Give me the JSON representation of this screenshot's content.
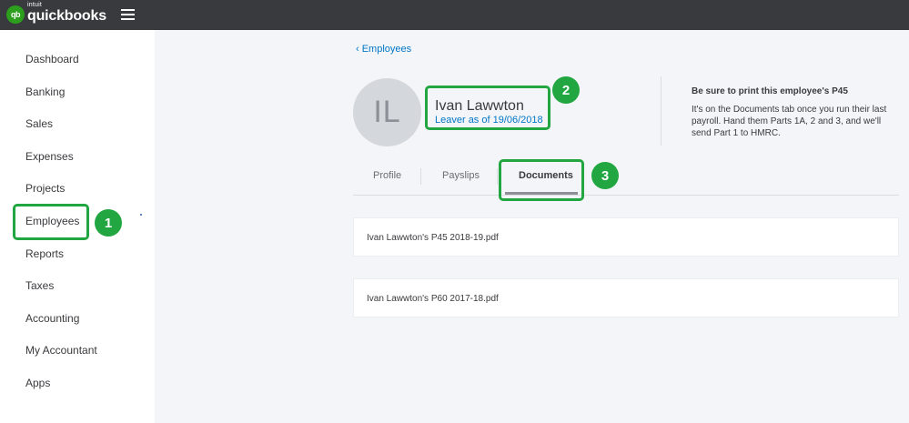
{
  "topbar": {
    "logo_mark": "qb",
    "logo_small": "intuit",
    "logo_word": "quickbooks",
    "menu_icon": "hamburger-icon"
  },
  "sidebar": {
    "items": [
      {
        "label": "Dashboard"
      },
      {
        "label": "Banking"
      },
      {
        "label": "Sales"
      },
      {
        "label": "Expenses"
      },
      {
        "label": "Projects"
      },
      {
        "label": "Employees"
      },
      {
        "label": "Reports"
      },
      {
        "label": "Taxes"
      },
      {
        "label": "Accounting"
      },
      {
        "label": "My Accountant"
      },
      {
        "label": "Apps"
      }
    ]
  },
  "employee": {
    "back_label": "‹ Employees",
    "initials": "IL",
    "name": "Ivan Lawwton",
    "status": "Leaver as of 19/06/2018"
  },
  "notice": {
    "title": "Be sure to print this employee's P45",
    "body": "It's on the Documents tab once you run their last payroll. Hand them Parts 1A, 2 and 3, and we'll send Part 1 to HMRC."
  },
  "tabs": [
    {
      "label": "Profile"
    },
    {
      "label": "Payslips"
    },
    {
      "label": "Documents",
      "active": true
    }
  ],
  "documents": [
    {
      "name": "Ivan Lawwton's P45 2018-19.pdf"
    },
    {
      "name": "Ivan Lawwton's P60 2017-18.pdf"
    }
  ],
  "callouts": [
    "1",
    "2",
    "3"
  ],
  "colors": {
    "topbar": "#393a3d",
    "brand_green": "#2ca01c",
    "callout_green": "#21a641",
    "link_blue": "#0077c5",
    "page_bg": "#f4f5f8"
  }
}
